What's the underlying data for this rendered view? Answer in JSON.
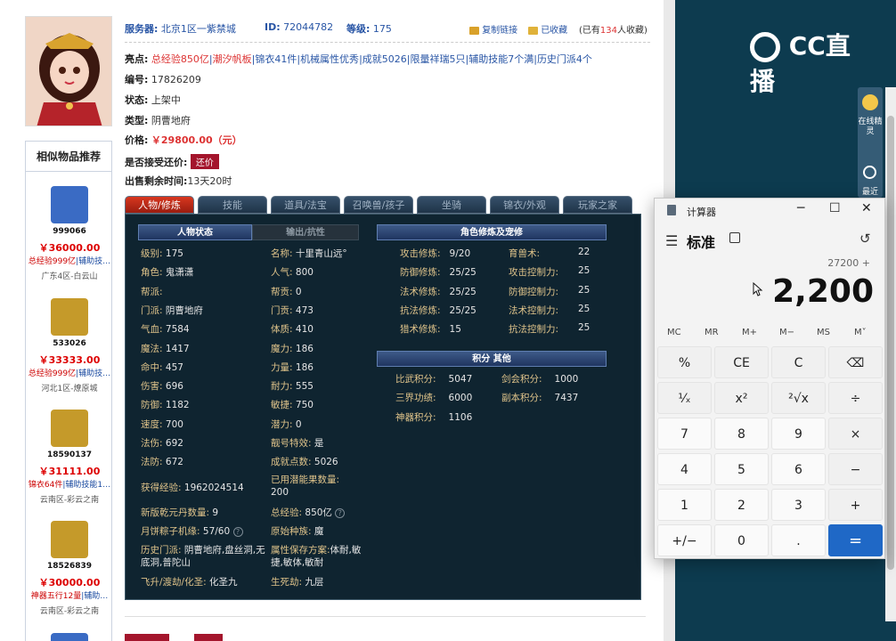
{
  "header": {
    "server_label": "服务器:",
    "server_value": "北京1区一紫禁城",
    "id_label": "ID:",
    "id_value": "72044782",
    "level_label": "等级:",
    "level_value": "175",
    "copy_link": "复制链接",
    "collected": "已收藏",
    "collect_count_prefix": "(已有",
    "collect_count": "134",
    "collect_count_suffix": "人收藏)"
  },
  "details": {
    "highlights_label": "亮点:",
    "highlights": [
      "总经验850亿",
      "潮汐帆板",
      "锦衣41件",
      "机械属性优秀",
      "成就5026",
      "限量祥瑞5只",
      "辅助技能7个满",
      "历史门派4个"
    ],
    "number_label": "编号:",
    "number_value": "17826209",
    "status_label": "状态:",
    "status_value": "上架中",
    "type_label": "类型:",
    "type_value": "阴曹地府",
    "price_label": "价格:",
    "price_value": "￥29800.00（元）",
    "bargain_label": "是否接受还价:",
    "bargain_button": "还价",
    "time_label": "出售剩余时间:",
    "time_value": "13天20时"
  },
  "tabs": [
    "人物/修炼",
    "技能",
    "道具/法宝",
    "召唤兽/孩子",
    "坐骑",
    "锦衣/外观",
    "玩家之家"
  ],
  "sections": {
    "char_status": "人物状态",
    "output": "输出/抗性",
    "cultivation": "角色修炼及宠修",
    "points": "积分 其他"
  },
  "stats_left": [
    {
      "k": "级别:",
      "v": "175"
    },
    {
      "k": "角色:",
      "v": "鬼潇潇"
    },
    {
      "k": "帮派:",
      "v": ""
    },
    {
      "k": "门派:",
      "v": "阴曹地府"
    },
    {
      "k": "气血:",
      "v": "7584"
    },
    {
      "k": "魔法:",
      "v": "1417"
    },
    {
      "k": "命中:",
      "v": "457"
    },
    {
      "k": "伤害:",
      "v": "696"
    },
    {
      "k": "防御:",
      "v": "1182"
    },
    {
      "k": "速度:",
      "v": "700"
    },
    {
      "k": "法伤:",
      "v": "692"
    },
    {
      "k": "法防:",
      "v": "672"
    }
  ],
  "stats_mid": [
    {
      "k": "名称:",
      "v": "十里青山远°"
    },
    {
      "k": "人气:",
      "v": "800"
    },
    {
      "k": "帮贡:",
      "v": "0"
    },
    {
      "k": "门贡:",
      "v": "473"
    },
    {
      "k": "体质:",
      "v": "410"
    },
    {
      "k": "魔力:",
      "v": "186"
    },
    {
      "k": "力量:",
      "v": "186"
    },
    {
      "k": "耐力:",
      "v": "555"
    },
    {
      "k": "敏捷:",
      "v": "750"
    },
    {
      "k": "潜力:",
      "v": "0"
    },
    {
      "k": "靓号特效:",
      "v": "是"
    },
    {
      "k": "成就点数:",
      "v": "5026"
    }
  ],
  "extra": {
    "exp_label": "获得经验:",
    "exp_value": "1962024514",
    "potential_label": "已用潜能果数量:",
    "potential_value": "200",
    "qiankun_label": "新版乾元丹数量:",
    "qiankun_value": "9",
    "total_exp_label": "总经验:",
    "total_exp_value": "850亿",
    "mooncake_label": "月饼粽子机缘:",
    "mooncake_value": "57/60",
    "origin_label": "原始种族:",
    "origin_value": "魔",
    "history_label": "历史门派:",
    "history_value": "阴曹地府,盘丝洞,无底洞,普陀山",
    "attr_save_label": "属性保存方案:",
    "attr_save_value": "体耐,敏捷,敏体,敏耐",
    "ascend_label": "飞升/渡劫/化圣:",
    "ascend_value": "化圣九",
    "life_label": "生死劫:",
    "life_value": "九层"
  },
  "cultivation": [
    {
      "k": "攻击修炼:",
      "v": "9/20",
      "k2": "育兽术:",
      "v2": "22"
    },
    {
      "k": "防御修炼:",
      "v": "25/25",
      "k2": "攻击控制力:",
      "v2": "25"
    },
    {
      "k": "法术修炼:",
      "v": "25/25",
      "k2": "防御控制力:",
      "v2": "25"
    },
    {
      "k": "抗法修炼:",
      "v": "25/25",
      "k2": "法术控制力:",
      "v2": "25"
    },
    {
      "k": "猎术修炼:",
      "v": "15",
      "k2": "抗法控制力:",
      "v2": "25"
    }
  ],
  "points": [
    {
      "k": "比武积分:",
      "v": "5047",
      "k2": "剑会积分:",
      "v2": "1000"
    },
    {
      "k": "三界功绩:",
      "v": "6000",
      "k2": "副本积分:",
      "v2": "7437"
    },
    {
      "k": "神器积分:",
      "v": "1106",
      "k2": "",
      "v2": ""
    }
  ],
  "similar": {
    "title": "相似物品推荐",
    "items": [
      {
        "id": "999066",
        "price": "￥36000.00",
        "desc_red": "总经验999亿",
        "desc_blue": "|辅助技…",
        "server": "广东4区-白云山",
        "color": "#3a6bc4"
      },
      {
        "id": "533026",
        "price": "￥33333.00",
        "desc_red": "总经验999亿",
        "desc_blue": "|辅助技…",
        "server": "河北1区-燎原城",
        "color": "#c59a2a"
      },
      {
        "id": "18590137",
        "price": "￥31111.00",
        "desc_red": "锦衣64件",
        "desc_blue": "|辅助技能1…",
        "server": "云南区-彩云之南",
        "color": "#c59a2a"
      },
      {
        "id": "18526839",
        "price": "￥30000.00",
        "desc_red": "神器五行12量",
        "desc_blue": "|辅助…",
        "server": "云南区-彩云之南",
        "color": "#c59a2a"
      }
    ]
  },
  "stream": {
    "logo_text": "CC直播",
    "side_online": "在线精灵",
    "side_recent": "最近"
  },
  "calculator": {
    "title": "计算器",
    "mode": "标准",
    "expression": "27200 +",
    "display": "2,200",
    "memory": [
      "MC",
      "MR",
      "M+",
      "M−",
      "MS",
      "M˅"
    ],
    "keys": [
      [
        "%",
        "CE",
        "C",
        "⌫"
      ],
      [
        "¹⁄ₓ",
        "x²",
        "²√x",
        "÷"
      ],
      [
        "7",
        "8",
        "9",
        "×"
      ],
      [
        "4",
        "5",
        "6",
        "−"
      ],
      [
        "1",
        "2",
        "3",
        "+"
      ],
      [
        "+/−",
        "0",
        ".",
        "="
      ]
    ]
  }
}
